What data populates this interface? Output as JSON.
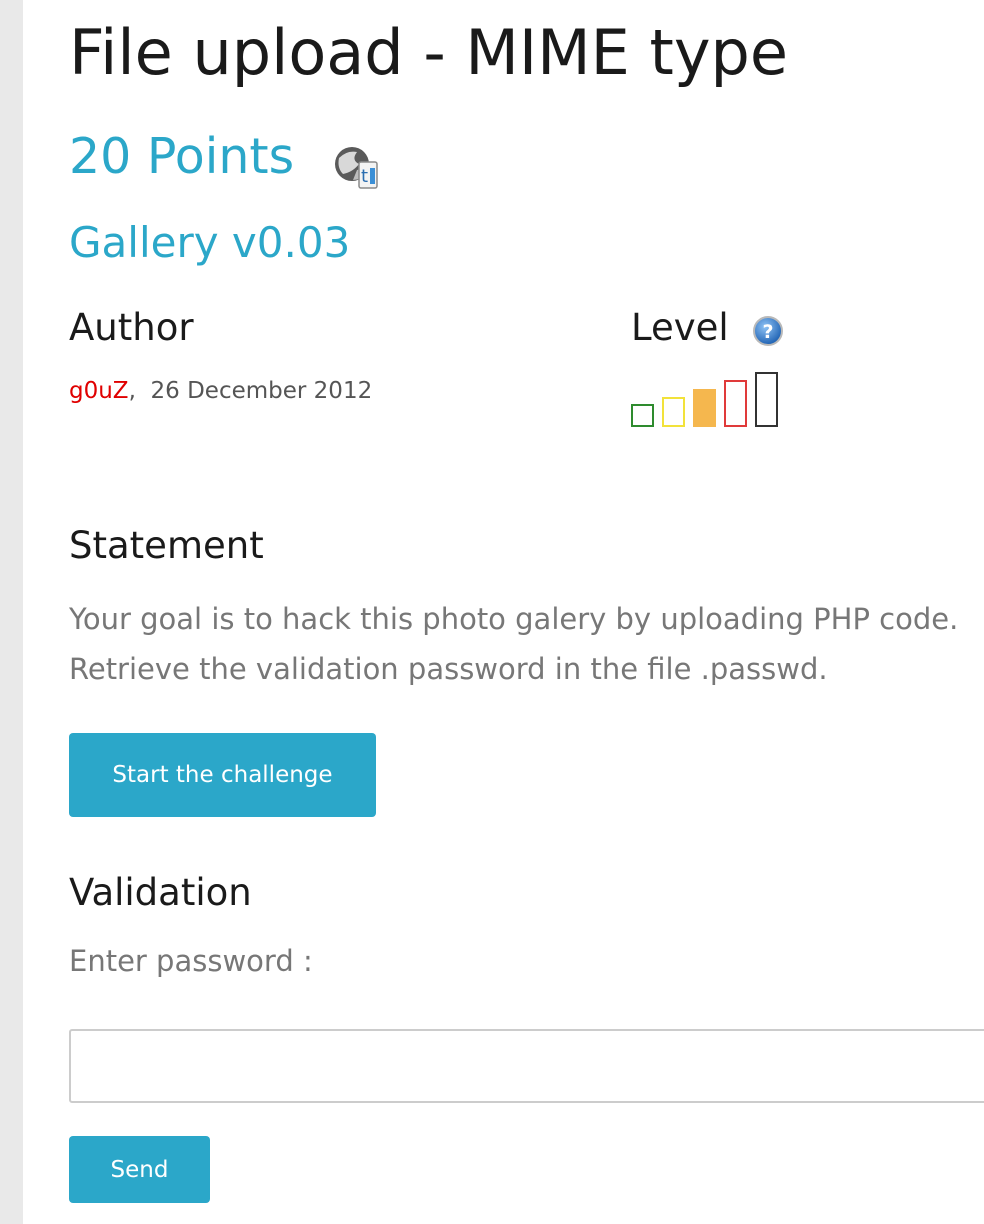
{
  "challenge": {
    "title": "File upload - MIME type",
    "points": "20 Points",
    "link_text": "Gallery v0.03"
  },
  "author": {
    "heading": "Author",
    "name": "g0uZ",
    "separator": ",",
    "date": "26 December 2012"
  },
  "level": {
    "heading": "Level",
    "value": 3,
    "max": 5
  },
  "statement": {
    "heading": "Statement",
    "lines": [
      "Your goal is to hack this photo galery by uploading PHP code.",
      "Retrieve the validation password in the file .passwd."
    ]
  },
  "start_button": {
    "label": "Start the challenge"
  },
  "validation": {
    "heading": "Validation",
    "label": "Enter password :",
    "input_value": "",
    "send_label": "Send"
  },
  "icons": {
    "points_icon": "web-server-globe-icon",
    "help_icon": "help-question-icon"
  },
  "colors": {
    "accent": "#2ba7c9",
    "author": "#e00000",
    "level_colors": [
      "#2e8b2e",
      "#f2e23a",
      "#f5b74e",
      "#e03a3a",
      "#333333"
    ]
  }
}
